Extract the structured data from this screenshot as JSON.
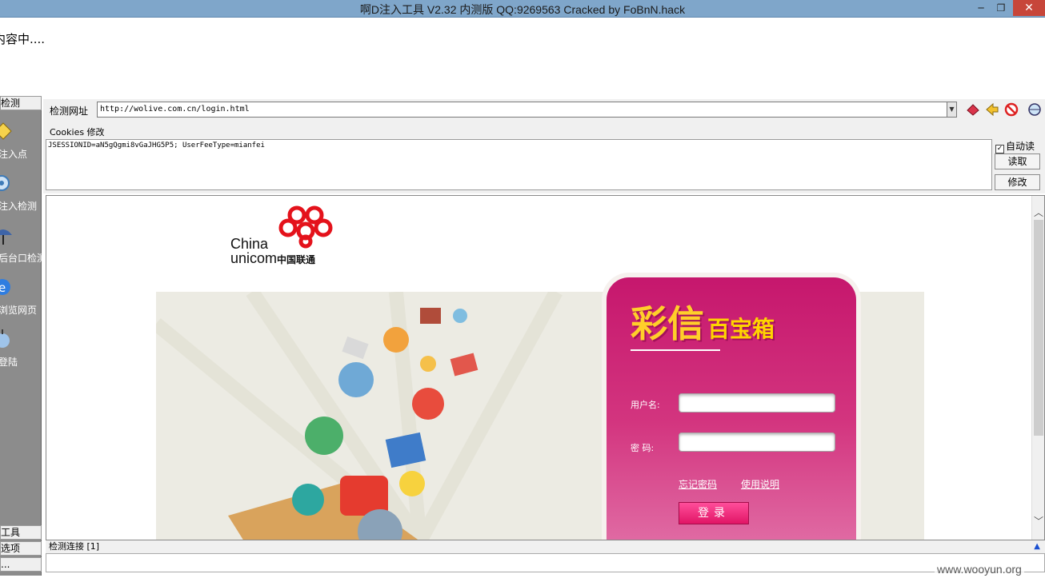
{
  "window": {
    "title": "啊D注入工具 V2.32 内测版 QQ:9269563 Cracked by FoBnN.hack",
    "min_glyph": "─",
    "max_glyph": "❐",
    "close_glyph": "✕"
  },
  "status": {
    "text": "内容中...."
  },
  "sidebar": {
    "top_header": "检测",
    "items": [
      {
        "label": "注入点",
        "icon": "folder-icon"
      },
      {
        "label": "注入检测",
        "icon": "gear-search-icon"
      },
      {
        "label": "后台口检测",
        "icon": "umbrella-icon"
      },
      {
        "label": "浏览网页",
        "icon": "ie-icon"
      },
      {
        "label": "登陆",
        "icon": "apple-icon"
      }
    ],
    "bottom_headers": [
      "工具",
      "选项",
      "..."
    ]
  },
  "urlbar": {
    "label": "检测网址",
    "value": "http://wolive.com.cn/login.html",
    "dropdown_glyph": "▼"
  },
  "cookies": {
    "label": "Cookies 修改",
    "value": "JSESSIONID=aN5gQgmi8vGaJHG5P5; UserFeeType=mianfei",
    "auto_read_check": "✓",
    "auto_read_label": "自动读",
    "read_button": "读取",
    "modify_button": "修改"
  },
  "webpage": {
    "logo_china": "China",
    "logo_unicom": "unicom",
    "logo_cn": "中国联通",
    "login_title": "彩信",
    "login_title_sub": "百宝箱",
    "username_label": "用户名:",
    "password_label": "密  码:",
    "forgot_link": "忘记密码",
    "help_link": "使用说明",
    "login_button": "登录",
    "scroll_up_glyph": "︿",
    "scroll_down_glyph": "﹀"
  },
  "bottom": {
    "detect_link_label": "检测连接 [1]",
    "arrow_glyph": "▲",
    "watermark": "www.wooyun.org"
  },
  "colors": {
    "titlebar": "#7fa6ca",
    "sidebar": "#8c8c8c",
    "login_panel": "#c6176d",
    "unicom_red": "#e4121b"
  }
}
